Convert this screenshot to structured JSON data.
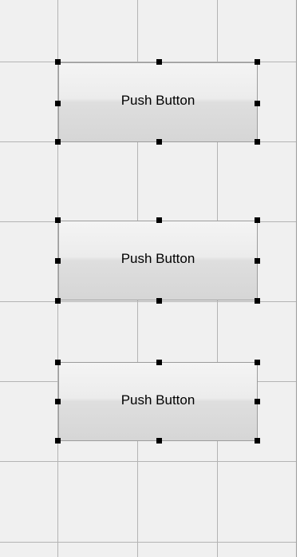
{
  "designer": {
    "buttons": [
      {
        "label": "Push Button",
        "selected": true
      },
      {
        "label": "Push Button",
        "selected": true
      },
      {
        "label": "Push Button",
        "selected": true
      }
    ]
  }
}
